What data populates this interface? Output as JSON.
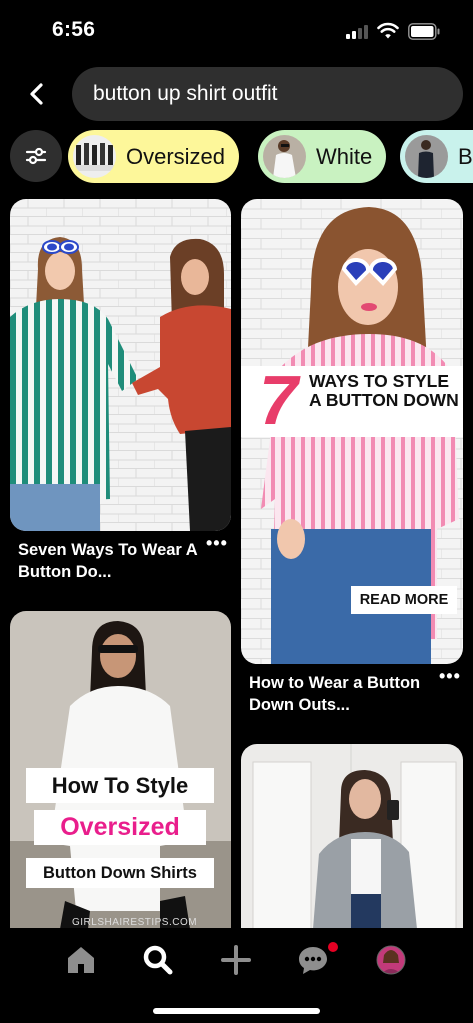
{
  "status_bar": {
    "time": "6:56"
  },
  "search": {
    "query": "button up shirt outfit"
  },
  "chips": [
    {
      "label": "Oversized",
      "color": "#fdf79a"
    },
    {
      "label": "White",
      "color": "#c9f2c1"
    },
    {
      "label": "B",
      "color": "#c9f2ec"
    }
  ],
  "pins": [
    {
      "title": "Seven Ways To Wear A Button Do...",
      "more": "•••"
    },
    {
      "title": "How to Wear a Button Down Outs...",
      "more": "•••",
      "overlay_number": "7",
      "overlay_text": "WAYS TO STYLE A BUTTON DOWN",
      "overlay_cta": "READ MORE"
    },
    {
      "overlay_line1": "How To Style",
      "overlay_line2": "Oversized",
      "overlay_line3": "Button Down Shirts",
      "watermark": "GIRLSHAIRESTIPS.COM"
    },
    {}
  ],
  "nav": {
    "items": [
      "home-icon",
      "search-icon",
      "plus-icon",
      "messages-icon",
      "profile-avatar"
    ],
    "notification_color": "#e60023"
  },
  "colors": {
    "accent_pink": "#ec407a",
    "chip_yellow": "#fdf79a",
    "chip_green": "#c9f2c1"
  }
}
